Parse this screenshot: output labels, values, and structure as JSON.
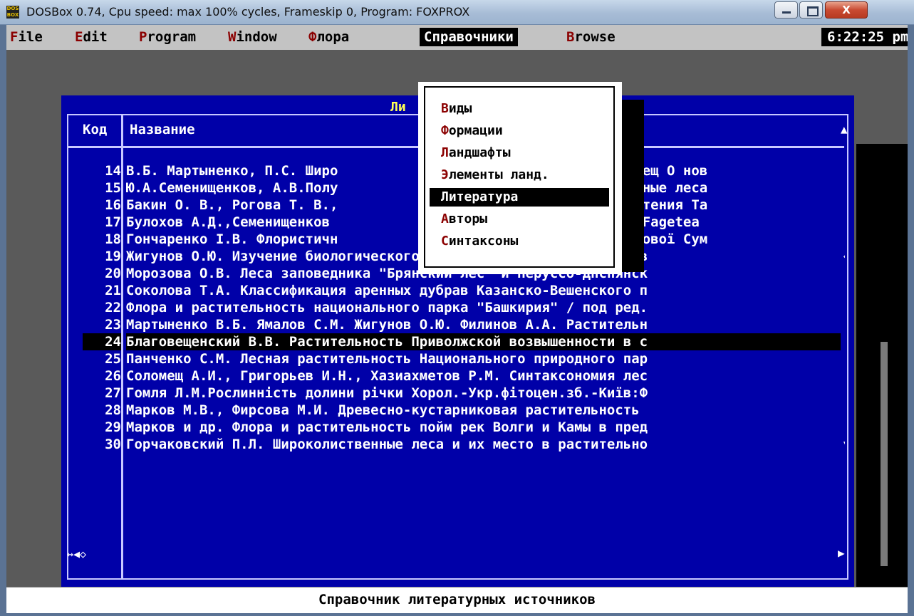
{
  "window": {
    "title": "DOSBox 0.74, Cpu speed: max 100% cycles, Frameskip  0, Program:  FOXPROX",
    "icon_text": "DOS BOX",
    "close_glyph": "X"
  },
  "menubar": {
    "items": [
      {
        "hotkey": "F",
        "rest": "ile"
      },
      {
        "hotkey": "E",
        "rest": "dit"
      },
      {
        "hotkey": "P",
        "rest": "rogram"
      },
      {
        "hotkey": "W",
        "rest": "indow"
      },
      {
        "hotkey": "Ф",
        "rest": "лора"
      },
      {
        "label": "Справочники"
      },
      {
        "hotkey": "B",
        "rest": "rowse"
      }
    ],
    "clock": "6:22:25 pm"
  },
  "browse": {
    "title": "Ли",
    "col_code": "Код",
    "col_name": "Название",
    "up_arrow": "▲",
    "foot_left": "↔◀◇",
    "foot_right": "▶",
    "rows": [
      {
        "code": "14",
        "name": "В.Б. Мартыненко, П.С. Широ",
        "tail": ", А.И. Соломещ О нов"
      },
      {
        "code": "15",
        "name": "Ю.А.Семенищенков, А.В.Полу",
        "tail": "ироколиственные леса"
      },
      {
        "code": "16",
        "name": "Бакин О. В., Рогова Т. В.,",
        "tail": "судистые растения Та"
      },
      {
        "code": "17",
        "name": "Булохов А.Д.,Семенищенков ",
        "tail": "асса Querco-Fagetea "
      },
      {
        "code": "18",
        "name": "Гончаренко І.В. Флористичн",
        "tail": "сів лісостепової Сум"
      },
      {
        "code": "19",
        "name": "Жигунов О.Ю. Изучение биологического разнообразия растений лесов",
        "mark": "◇"
      },
      {
        "code": "20",
        "name": "Морозова О.В. Леса заповедника \"Брянский лес\" и Неруссо-Днснянск"
      },
      {
        "code": "21",
        "name": "Соколова Т.А. Классификация аренных дубрав Казанско-Вешенского п"
      },
      {
        "code": "22",
        "name": "Флора и растительность национального парка \"Башкирия\" / под ред."
      },
      {
        "code": "23",
        "name": "Мартыненко В.Б. Ямалов С.М. Жигунов О.Ю. Филинов А.А. Растительн"
      },
      {
        "code": "24",
        "name": "Благовещенский В.В. Растительность Приволжской возвышенности в с",
        "selected": true
      },
      {
        "code": "25",
        "name": "Панченко С.М. Лесная растительность Национального природного пар"
      },
      {
        "code": "26",
        "name": "Соломещ А.И., Григорьев И.Н., Хазиахметов Р.М. Синтаксономия лес"
      },
      {
        "code": "27",
        "name": "Гомля Л.М.Рослинність долини річки Хорол.-Укр.фітоцен.зб.-Київ:Ф"
      },
      {
        "code": "28",
        "name": "Марков М.В., Фирсова М.И. Древесно-кустарниковая растительность "
      },
      {
        "code": "29",
        "name": "Марков и др. Флора и растительность пойм рек Волги и Камы в пред"
      },
      {
        "code": "30",
        "name": "Горчаковский П.Л. Широколиственные леса и их место в растительно",
        "mark": "▼"
      }
    ]
  },
  "dropdown": {
    "items": [
      {
        "hotkey": "В",
        "rest": "иды"
      },
      {
        "hotkey": "Ф",
        "rest": "ормации"
      },
      {
        "hotkey": "Л",
        "rest": "андшафты"
      },
      {
        "hotkey": "Э",
        "rest": "лементы ланд."
      },
      {
        "label": "Литература",
        "selected": true
      },
      {
        "hotkey": "А",
        "rest": "вторы"
      },
      {
        "hotkey": "С",
        "rest": "интаксоны"
      }
    ]
  },
  "status": {
    "text": "Справочник литературных источников"
  },
  "colors": {
    "browse_bg": "#0000a8",
    "text": "#ffffff",
    "hotkey": "#8b0000",
    "title_yellow": "#ffff55",
    "menubar_bg": "#c3c3c3"
  }
}
